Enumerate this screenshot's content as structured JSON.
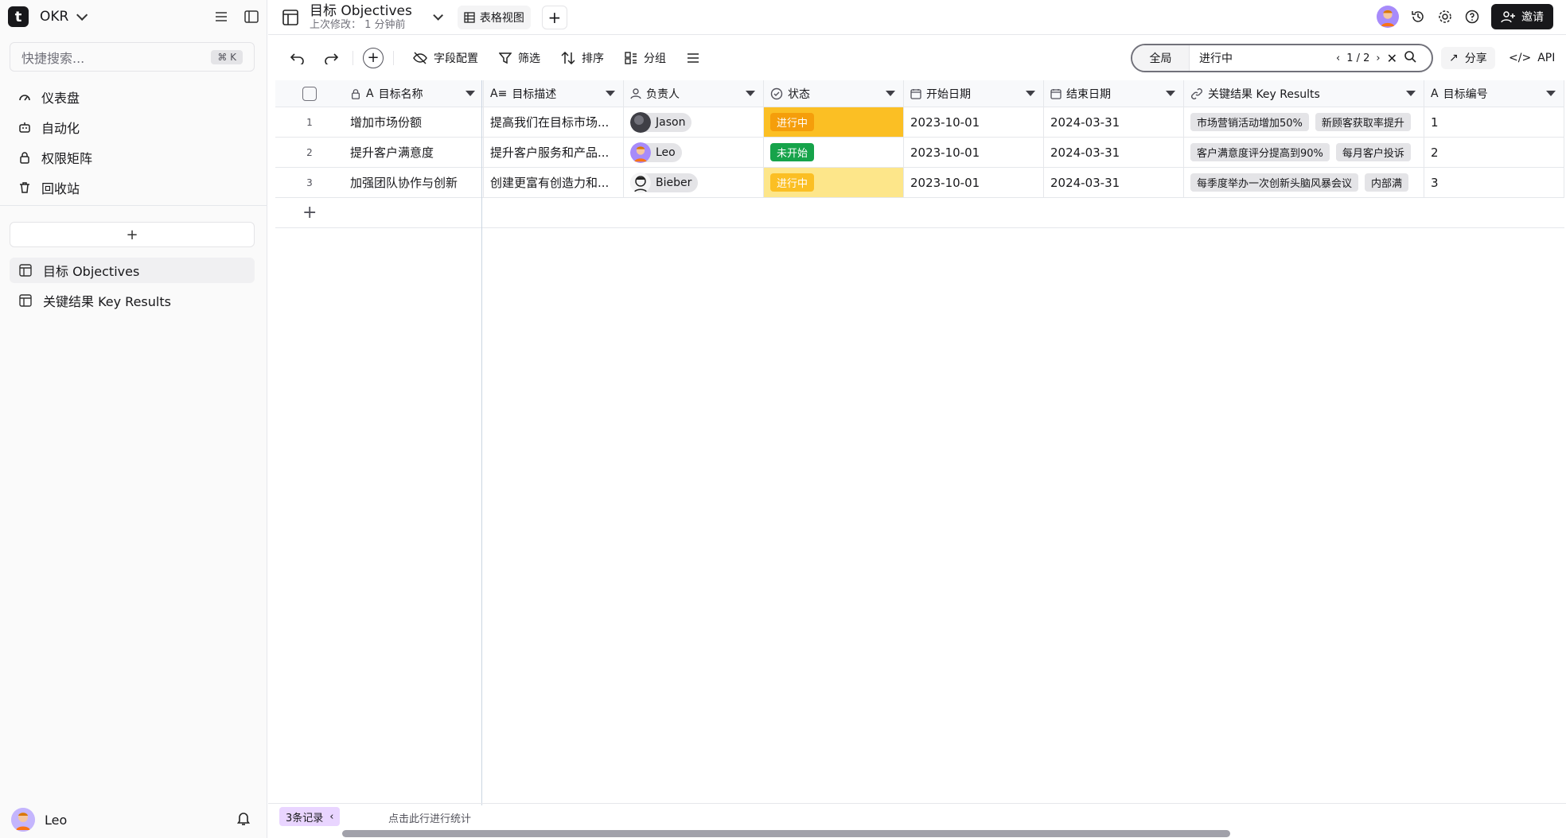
{
  "sidebar": {
    "space_name": "OKR",
    "logo_letter": "t",
    "search_placeholder": "快捷搜索...",
    "search_shortcut": "⌘ K",
    "nav": [
      {
        "label": "仪表盘",
        "icon": "gauge-icon"
      },
      {
        "label": "自动化",
        "icon": "robot-icon"
      },
      {
        "label": "权限矩阵",
        "icon": "lock-icon"
      },
      {
        "label": "回收站",
        "icon": "trash-icon"
      }
    ],
    "add_label": "+",
    "tables": [
      {
        "label": "目标 Objectives",
        "active": true
      },
      {
        "label": "关键结果 Key Results",
        "active": false
      }
    ],
    "user_name": "Leo"
  },
  "header": {
    "table_title": "目标 Objectives",
    "last_modified": "上次修改：  1 分钟前",
    "view_tab": "表格视图",
    "add_view": "+",
    "invite_label": "邀请"
  },
  "toolbar": {
    "field_config": "字段配置",
    "filter": "筛选",
    "sort": "排序",
    "group": "分组",
    "search_scope": "全局",
    "search_value": "进行中",
    "match_count": "1 / 2",
    "share": "分享",
    "api": "API"
  },
  "grid": {
    "columns": [
      {
        "label": "目标名称",
        "icon": "text-icon"
      },
      {
        "label": "目标描述",
        "icon": "long-text-icon"
      },
      {
        "label": "负责人",
        "icon": "user-icon"
      },
      {
        "label": "状态",
        "icon": "status-icon"
      },
      {
        "label": "开始日期",
        "icon": "calendar-icon"
      },
      {
        "label": "结束日期",
        "icon": "calendar-icon"
      },
      {
        "label": "关键结果 Key Results",
        "icon": "link-icon"
      },
      {
        "label": "目标编号",
        "icon": "text-icon"
      }
    ],
    "rows": [
      {
        "num": "1",
        "name": "增加市场份额",
        "desc": "提高我们在目标市场...",
        "owner": "Jason",
        "status": "进行中",
        "start": "2023-10-01",
        "end": "2024-03-31",
        "kr1": "市场营销活动增加50%",
        "kr2": "新顾客获取率提升",
        "code": "1"
      },
      {
        "num": "2",
        "name": "提升客户满意度",
        "desc": "提升客户服务和产品...",
        "owner": "Leo",
        "status": "未开始",
        "start": "2023-10-01",
        "end": "2024-03-31",
        "kr1": "客户满意度评分提高到90%",
        "kr2": "每月客户投诉",
        "code": "2"
      },
      {
        "num": "3",
        "name": "加强团队协作与创新",
        "desc": "创建更富有创造力和...",
        "owner": "Bieber",
        "status": "进行中",
        "start": "2023-10-01",
        "end": "2024-03-31",
        "kr1": "每季度举办一次创新头脑风暴会议",
        "kr2": "内部满",
        "code": "3"
      }
    ],
    "add_row": "+"
  },
  "footer": {
    "record_count": "3条记录",
    "stat_hint": "点击此行进行统计"
  },
  "colors": {
    "status_in_progress": "#f59e0b",
    "status_not_started": "#16a34a",
    "active_search_highlight": "#fbbf24",
    "secondary_search_highlight": "#fde68a",
    "record_badge": "#e9d5ff"
  }
}
